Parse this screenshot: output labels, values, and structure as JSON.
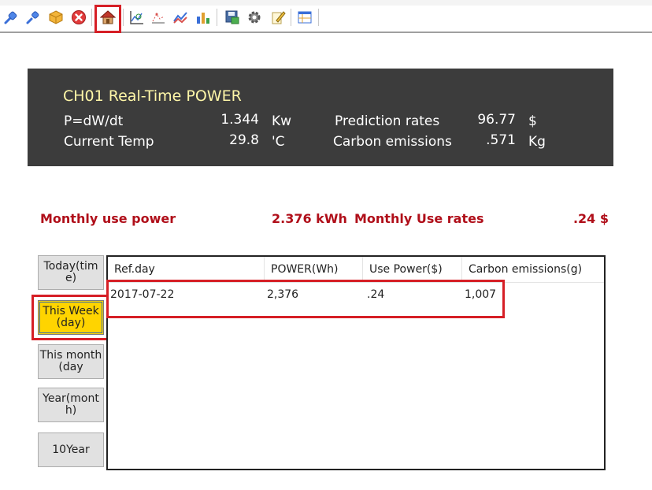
{
  "toolbar": {
    "icons": [
      "plug-connect-icon",
      "plug-disconnect-icon",
      "box-icon",
      "close-icon",
      "home-icon",
      "chart-zoom-icon",
      "chart-dots-icon",
      "chart-line-icon",
      "bar-chart-icon",
      "save-icon",
      "gear-icon",
      "edit-icon",
      "grid-table-icon"
    ],
    "colors": {
      "highlight": "#d61f26"
    }
  },
  "realtime": {
    "title": "CH01  Real-Time POWER",
    "power_label": "P=dW/dt",
    "power_value": "1.344",
    "power_unit": "Kw",
    "temp_label": "Current Temp",
    "temp_value": "29.8",
    "temp_unit": "'C",
    "prediction_label": "Prediction rates",
    "prediction_value": "96.77",
    "prediction_unit": "$",
    "carbon_label": "Carbon emissions",
    "carbon_value": ".571",
    "carbon_unit": "Kg"
  },
  "monthly": {
    "use_power_label": "Monthly use power",
    "use_power_value": "2.376 kWh",
    "use_rates_label": "Monthly Use rates",
    "use_rates_value": ".24 $"
  },
  "side_buttons": [
    {
      "label": "Today(time)",
      "active": false
    },
    {
      "label": "This Week(day)",
      "active": true
    },
    {
      "label": "This month(day",
      "active": false
    },
    {
      "label": "Year(month)",
      "active": false
    },
    {
      "label": "10Year",
      "active": false
    }
  ],
  "table": {
    "headers": [
      "Ref.day",
      "POWER(Wh)",
      "Use Power($)",
      "Carbon emissions(g)"
    ],
    "rows": [
      [
        "2017-07-22",
        "2,376",
        ".24",
        "1,007"
      ]
    ]
  }
}
